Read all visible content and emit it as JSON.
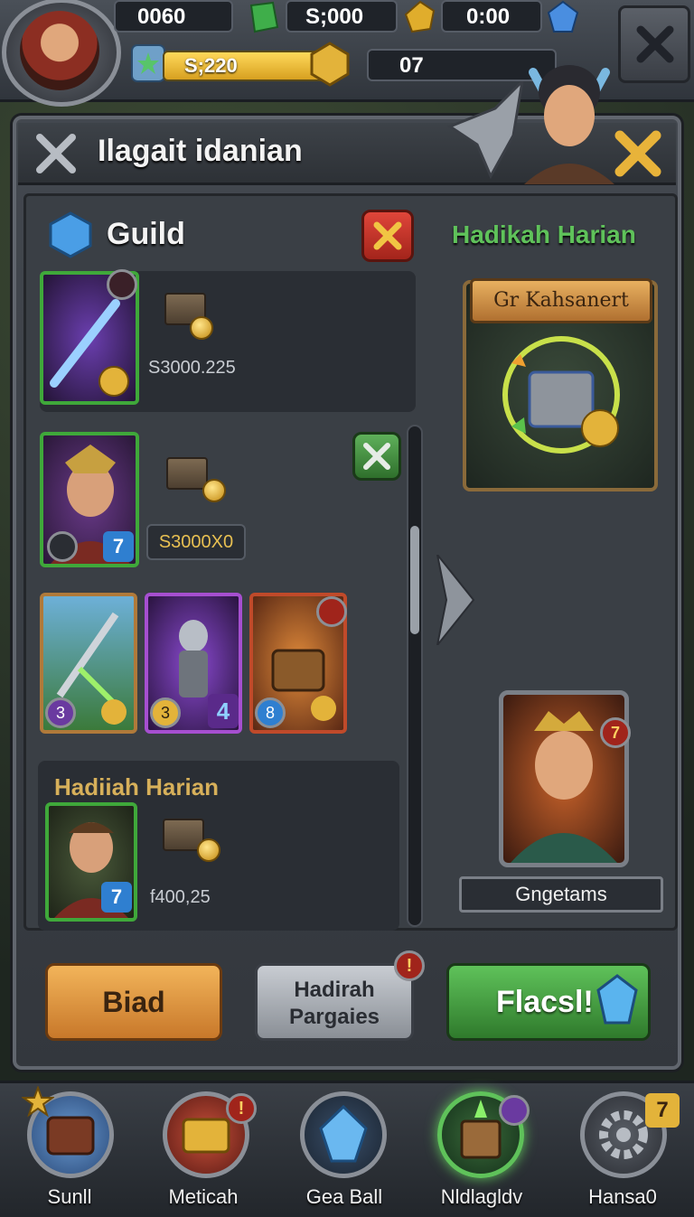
{
  "topbar": {
    "resource1": "0060",
    "resource2": "S;000",
    "resource3": "0:00",
    "xp_value": "S;220",
    "level_value": "07"
  },
  "dialog": {
    "title": "Ilagait idanian"
  },
  "guild": {
    "title": "Guild",
    "items": [
      {
        "price": "S3000.225"
      },
      {
        "price": "S3000X0",
        "badge": "7"
      },
      {
        "price": "f400,25",
        "badge": "7",
        "section_title": "Hadiiah Harian"
      }
    ],
    "mini_cards": [
      {
        "badge": "3"
      },
      {
        "badge": "3",
        "count": "4"
      },
      {
        "badge": "8"
      }
    ]
  },
  "reward": {
    "heading": "Hadikah Harian",
    "banner": "Gr Kahsanert",
    "hero_badge": "7",
    "hero_label": "Gngetams"
  },
  "buttons": {
    "left": "Biad",
    "middle_line1": "Hadirah",
    "middle_line2": "Pargaies",
    "middle_badge": "!",
    "right": "Flacsl!"
  },
  "nav": {
    "items": [
      {
        "label": "Sunll",
        "badge": ""
      },
      {
        "label": "Meticah",
        "badge": "!"
      },
      {
        "label": "Gea Ball",
        "badge": ""
      },
      {
        "label": "Nldlagldv",
        "badge": ""
      },
      {
        "label": "Hansa0",
        "badge": "7"
      }
    ]
  },
  "colors": {
    "accent_green": "#3fa83a",
    "gold": "#e3b33a",
    "orange_button": "#e39a3c",
    "green_button": "#3d9b3a"
  }
}
